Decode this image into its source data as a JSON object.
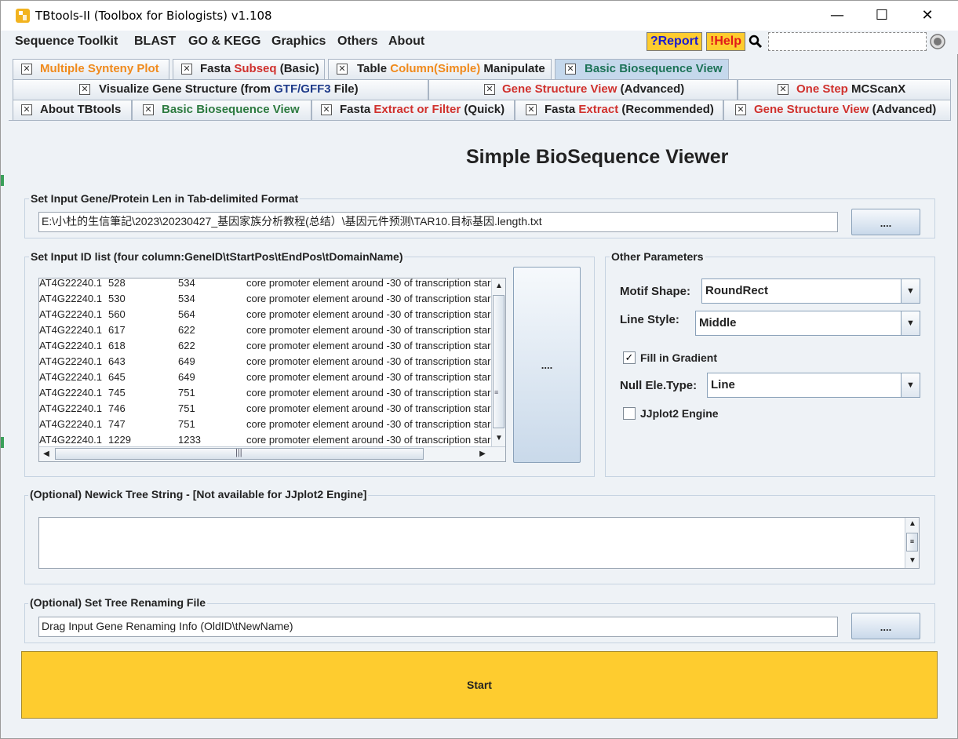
{
  "window": {
    "title": "TBtools-II (Toolbox for Biologists) v1.108",
    "minimize": "—",
    "maximize": "☐",
    "close": "✕"
  },
  "menu": [
    "Sequence Toolkit",
    "BLAST",
    "GO & KEGG",
    "Graphics",
    "Others",
    "About"
  ],
  "toolbar": {
    "report_label": "?Report",
    "help_label": "!Help",
    "search_value": ""
  },
  "tabs": {
    "row1": [
      {
        "parts": [
          "Multiple Synteny Plot"
        ]
      },
      {
        "parts": [
          "Fasta ",
          "Subseq",
          " (Basic)"
        ]
      },
      {
        "parts": [
          "Table ",
          "Column(Simple)",
          " Manipulate"
        ]
      },
      {
        "parts": [
          "Basic Biosequence View"
        ]
      }
    ],
    "row2": [
      {
        "parts": [
          "Visualize Gene Structure (from ",
          "GTF/GFF3",
          " File)"
        ]
      },
      {
        "parts": [
          "Gene Structure View",
          " (Advanced)"
        ]
      },
      {
        "parts": [
          "One Step",
          " MCScanX"
        ]
      }
    ],
    "row3": [
      {
        "parts": [
          "About TBtools"
        ]
      },
      {
        "parts": [
          "Basic Biosequence View"
        ]
      },
      {
        "parts": [
          "Fasta ",
          "Extract or Filter",
          " (Quick)"
        ]
      },
      {
        "parts": [
          "Fasta ",
          "Extract",
          " (Recommended)"
        ]
      },
      {
        "parts": [
          "Gene Structure View",
          " (Advanced)"
        ]
      }
    ]
  },
  "main": {
    "heading": "Simple BioSequence Viewer",
    "len_group_title": "Set Input Gene/Protein Len in Tab-delimited Format",
    "len_path": "E:\\小杜的生信筆記\\2023\\20230427_基因家族分析教程(总结）\\基因元件预测\\TAR10.目标基因.length.txt",
    "browse_label": "....",
    "id_group_title": "Set Input ID list (four column:GeneID\\tStartPos\\tEndPos\\tDomainName)",
    "id_rows": [
      {
        "id": "AT4G22240.1",
        "start": "528",
        "end": "534",
        "desc": "core promoter element around -30 of transcription star"
      },
      {
        "id": "AT4G22240.1",
        "start": "530",
        "end": "534",
        "desc": "core promoter element around -30 of transcription star"
      },
      {
        "id": "AT4G22240.1",
        "start": "560",
        "end": "564",
        "desc": "core promoter element around -30 of transcription star"
      },
      {
        "id": "AT4G22240.1",
        "start": "617",
        "end": "622",
        "desc": "core promoter element around -30 of transcription star"
      },
      {
        "id": "AT4G22240.1",
        "start": "618",
        "end": "622",
        "desc": "core promoter element around -30 of transcription star"
      },
      {
        "id": "AT4G22240.1",
        "start": "643",
        "end": "649",
        "desc": "core promoter element around -30 of transcription star"
      },
      {
        "id": "AT4G22240.1",
        "start": "645",
        "end": "649",
        "desc": "core promoter element around -30 of transcription star"
      },
      {
        "id": "AT4G22240.1",
        "start": "745",
        "end": "751",
        "desc": "core promoter element around -30 of transcription star"
      },
      {
        "id": "AT4G22240.1",
        "start": "746",
        "end": "751",
        "desc": "core promoter element around -30 of transcription star"
      },
      {
        "id": "AT4G22240.1",
        "start": "747",
        "end": "751",
        "desc": "core promoter element around -30 of transcription star"
      },
      {
        "id": "AT4G22240.1",
        "start": "1229",
        "end": "1233",
        "desc": "core promoter element around -30 of transcription star"
      }
    ],
    "id_browse_label": "....",
    "other_params_title": "Other Parameters",
    "motif_shape_label": "Motif Shape:",
    "motif_shape_value": "RoundRect",
    "line_style_label": "Line Style:",
    "line_style_value": "Middle",
    "fill_gradient_label": "Fill in Gradient",
    "fill_gradient_checked": true,
    "null_ele_label": "Null Ele.Type:",
    "null_ele_value": "Line",
    "jjplot_label": "JJplot2 Engine",
    "jjplot_checked": false,
    "newick_title": "(Optional) Newick Tree String - [Not available for JJplot2 Engine]",
    "newick_value": "",
    "rename_title": "(Optional) Set Tree Renaming File",
    "rename_placeholder": "Drag Input Gene Renaming Info (OldID\\tNewName)",
    "rename_browse_label": "....",
    "start_label": "Start"
  }
}
